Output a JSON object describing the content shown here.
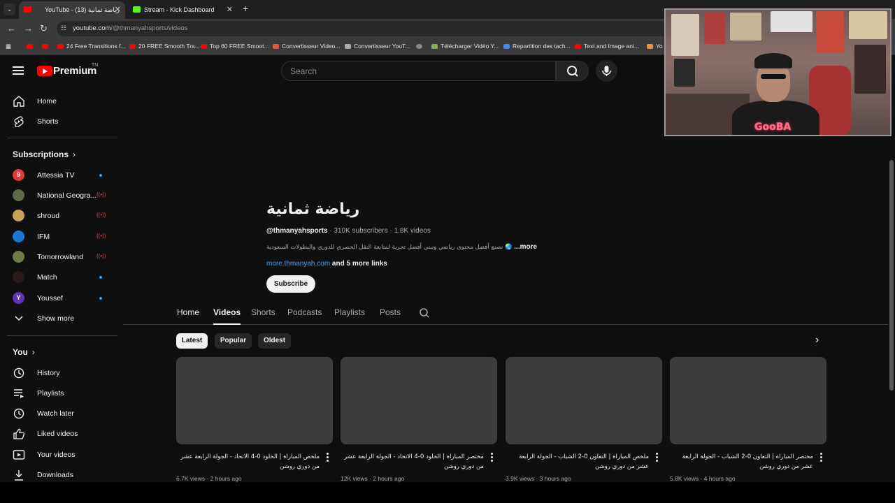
{
  "browser": {
    "tabs": [
      {
        "title": "YouTube - رياضة ثمانية (13)",
        "active": true
      },
      {
        "title": "Stream - Kick Dashboard",
        "active": false
      }
    ],
    "url_host": "youtube.com",
    "url_path": "/@thmanyahsports/videos",
    "bookmarks": [
      "24 Free Transitions f...",
      "20 FREE Smooth Tra...",
      "Top 60 FREE Smoot...",
      "Convertisseur Video...",
      "Convertisseur YouT...",
      "Télécharger Vidéo Y...",
      "Repartition des tach...",
      "Text and Image ani...",
      "Yo"
    ]
  },
  "yt": {
    "logo_text": "Premium",
    "logo_tm": "TN",
    "search_placeholder": "Search"
  },
  "sidebar": {
    "main": [
      {
        "label": "Home",
        "icon": "home-icon"
      },
      {
        "label": "Shorts",
        "icon": "shorts-icon"
      }
    ],
    "subscriptions_title": "Subscriptions",
    "subscriptions": [
      {
        "label": "Attessia TV",
        "avatar": "9",
        "color": "#e53935",
        "status": "dot"
      },
      {
        "label": "National Geogra...",
        "avatar": "",
        "color": "#5d6b4a",
        "status": "live"
      },
      {
        "label": "shroud",
        "avatar": "",
        "color": "#c9a25a",
        "status": "live"
      },
      {
        "label": "IFM",
        "avatar": "",
        "color": "#1976d2",
        "status": "live"
      },
      {
        "label": "Tomorrowland",
        "avatar": "",
        "color": "#6d7a4a",
        "status": "live"
      },
      {
        "label": "Match",
        "avatar": "",
        "color": "#2b1b1b",
        "status": "dot"
      },
      {
        "label": "Youssef",
        "avatar": "Y",
        "color": "#5e35b1",
        "status": "dot"
      }
    ],
    "show_more": "Show more",
    "you_title": "You",
    "you_items": [
      {
        "label": "History",
        "icon": "history-icon"
      },
      {
        "label": "Playlists",
        "icon": "playlists-icon"
      },
      {
        "label": "Watch later",
        "icon": "watch-later-icon"
      },
      {
        "label": "Liked videos",
        "icon": "thumbs-up-icon"
      },
      {
        "label": "Your videos",
        "icon": "your-videos-icon"
      },
      {
        "label": "Downloads",
        "icon": "download-icon"
      }
    ]
  },
  "channel": {
    "name": "رياضة ثمانية",
    "handle": "@thmanyahsports",
    "meta": " · 310K subscribers · 1.8K videos",
    "description": "نصنع أفضل محتوى رياضي ونبني أفضل تجربة لمتابعة النقل الحصري للدوري والبطولات السعودية",
    "more": "...more",
    "link": "more.thmanyah.com",
    "more_links": " and 5 more links",
    "subscribe": "Subscribe",
    "tabs": [
      "Home",
      "Videos",
      "Shorts",
      "Podcasts",
      "Playlists",
      "Posts"
    ],
    "selected_tab": "Videos",
    "chips": [
      "Latest",
      "Popular",
      "Oldest"
    ],
    "selected_chip": "Latest"
  },
  "videos": [
    {
      "title": "ملخص المباراة | الخلود 0-4 الاتحاد - الجولة الرابعة عشر من دوري روشن",
      "meta": "6.7K views · 2 hours ago"
    },
    {
      "title": "مختصر المباراة | الخلود 0-4 الاتحاد - الجولة الرابعة عشر من دوري روشن",
      "meta": "12K views · 2 hours ago"
    },
    {
      "title": "ملخص المباراة | التعاون 0-2 الشباب - الجولة الرابعة عشر من دوري روشن",
      "meta": "3.9K views · 3 hours ago"
    },
    {
      "title": "مختصر المباراة | التعاون 0-2 الشباب - الجولة الرابعة عشر من دوري روشن",
      "meta": "5.8K views · 4 hours ago"
    }
  ],
  "webcam": {
    "name": "GooBA"
  }
}
